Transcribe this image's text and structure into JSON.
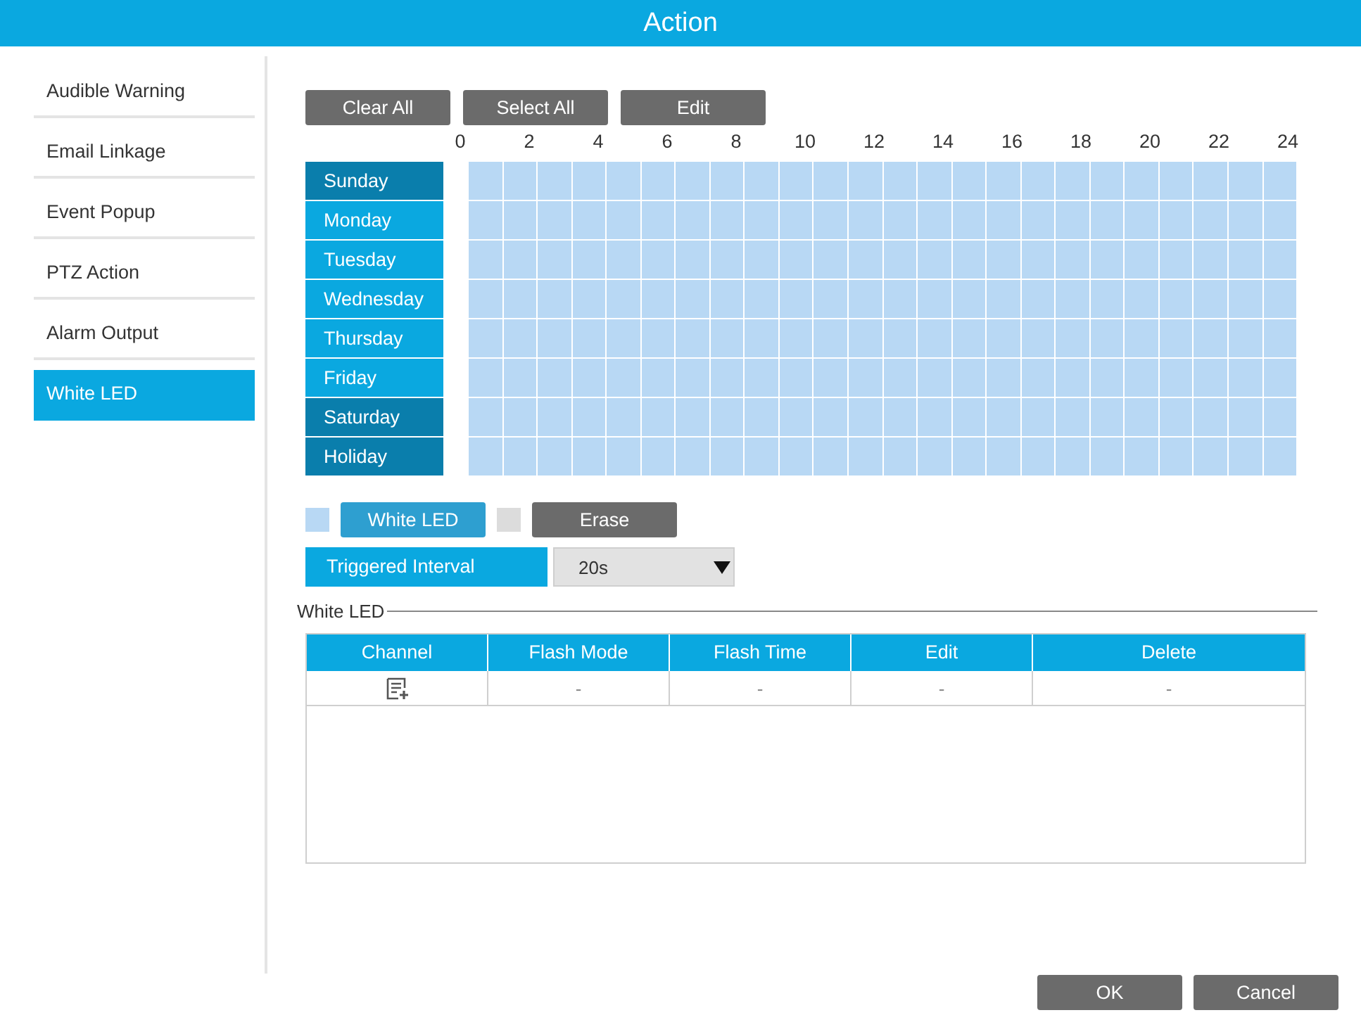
{
  "window": {
    "title": "Action"
  },
  "sidebar": {
    "items": [
      {
        "label": "Audible Warning",
        "selected": false
      },
      {
        "label": "Email Linkage",
        "selected": false
      },
      {
        "label": "Event Popup",
        "selected": false
      },
      {
        "label": "PTZ Action",
        "selected": false
      },
      {
        "label": "Alarm Output",
        "selected": false
      },
      {
        "label": "White LED",
        "selected": true
      }
    ]
  },
  "toolbar": [
    "Clear All",
    "Select All",
    "Edit"
  ],
  "schedule": {
    "hours": [
      "0",
      "2",
      "4",
      "6",
      "8",
      "10",
      "12",
      "14",
      "16",
      "18",
      "20",
      "22",
      "24"
    ],
    "days": [
      {
        "label": "Sunday",
        "kind": "weekend",
        "scheduled": true
      },
      {
        "label": "Monday",
        "kind": "weekday",
        "scheduled": true
      },
      {
        "label": "Tuesday",
        "kind": "weekday",
        "scheduled": true
      },
      {
        "label": "Wednesday",
        "kind": "weekday",
        "scheduled": true
      },
      {
        "label": "Thursday",
        "kind": "weekday",
        "scheduled": true
      },
      {
        "label": "Friday",
        "kind": "weekday",
        "scheduled": true
      },
      {
        "label": "Saturday",
        "kind": "weekend",
        "scheduled": true
      },
      {
        "label": "Holiday",
        "kind": "holiday",
        "scheduled": true
      }
    ]
  },
  "legend": [
    {
      "label": "White LED",
      "color": "#b8d8f4",
      "kind": "brush"
    },
    {
      "label": "Erase",
      "color": "#dcdcdc",
      "kind": "eraser"
    }
  ],
  "triggered_interval": {
    "label": "Triggered Interval",
    "value": "20s"
  },
  "white_led": {
    "title": "White LED",
    "columns": [
      "Channel",
      "Flash Mode",
      "Flash Time",
      "Edit",
      "Delete"
    ],
    "rows": [
      [
        "",
        "-",
        "-",
        "-",
        "-"
      ]
    ]
  },
  "buttons": [
    "OK",
    "Cancel"
  ]
}
